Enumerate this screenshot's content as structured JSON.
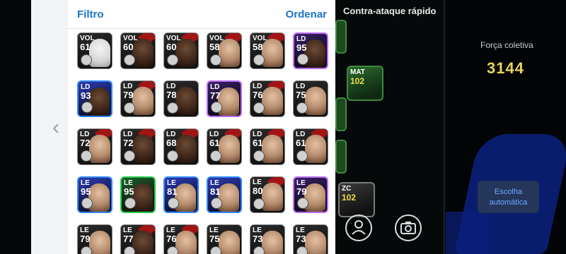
{
  "panel": {
    "filter_label": "Filtro",
    "order_label": "Ordenar"
  },
  "formation": {
    "title": "Contra-ataque rápido",
    "field_card": {
      "position": "MAT",
      "rating": "102"
    },
    "field_card_2": {
      "position": "ZC",
      "rating": "102"
    }
  },
  "team": {
    "strength_label": "Força coletiva",
    "strength_value": "3144",
    "auto_select_label": "Escolha automática"
  },
  "colors": {
    "accent_blue": "#1a73c8",
    "strength_yellow": "#e6d25a",
    "auto_button_bg": "#24365a"
  },
  "players": [
    {
      "pos": "VOL",
      "rating": "61",
      "style": "plain",
      "face": "blank",
      "stripe": false
    },
    {
      "pos": "VOL",
      "rating": "60",
      "style": "plain",
      "face": "dark",
      "stripe": true
    },
    {
      "pos": "VOL",
      "rating": "60",
      "style": "plain",
      "face": "dark",
      "stripe": true
    },
    {
      "pos": "VOL",
      "rating": "58",
      "style": "plain",
      "face": "light",
      "stripe": true
    },
    {
      "pos": "VOL",
      "rating": "58",
      "style": "plain",
      "face": "light",
      "stripe": true
    },
    {
      "pos": "LD",
      "rating": "95",
      "style": "purple",
      "face": "dark",
      "stripe": false
    },
    {
      "pos": "LD",
      "rating": "93",
      "style": "blue",
      "face": "dark",
      "stripe": false
    },
    {
      "pos": "LD",
      "rating": "79",
      "style": "plain",
      "face": "light",
      "stripe": true
    },
    {
      "pos": "LD",
      "rating": "78",
      "style": "plain",
      "face": "dark",
      "stripe": false
    },
    {
      "pos": "LD",
      "rating": "77",
      "style": "purple",
      "face": "light",
      "stripe": false
    },
    {
      "pos": "LD",
      "rating": "76",
      "style": "plain",
      "face": "light",
      "stripe": true
    },
    {
      "pos": "LD",
      "rating": "75",
      "style": "plain",
      "face": "light",
      "stripe": false
    },
    {
      "pos": "LD",
      "rating": "72",
      "style": "plain",
      "face": "light",
      "stripe": true
    },
    {
      "pos": "LD",
      "rating": "72",
      "style": "plain",
      "face": "dark",
      "stripe": true
    },
    {
      "pos": "LD",
      "rating": "68",
      "style": "plain",
      "face": "dark",
      "stripe": true
    },
    {
      "pos": "LD",
      "rating": "61",
      "style": "plain",
      "face": "light",
      "stripe": true
    },
    {
      "pos": "LD",
      "rating": "61",
      "style": "plain",
      "face": "light",
      "stripe": true
    },
    {
      "pos": "LD",
      "rating": "61",
      "style": "plain",
      "face": "light",
      "stripe": true
    },
    {
      "pos": "LE",
      "rating": "95",
      "style": "blue",
      "face": "light",
      "stripe": false
    },
    {
      "pos": "LE",
      "rating": "95",
      "style": "green",
      "face": "dark",
      "stripe": false
    },
    {
      "pos": "LE",
      "rating": "81",
      "style": "blue",
      "face": "light",
      "stripe": false
    },
    {
      "pos": "LE",
      "rating": "81",
      "style": "blue",
      "face": "light",
      "stripe": false
    },
    {
      "pos": "LE",
      "rating": "80",
      "style": "plain",
      "face": "light",
      "stripe": true
    },
    {
      "pos": "LE",
      "rating": "79",
      "style": "purple",
      "face": "light",
      "stripe": false
    },
    {
      "pos": "LE",
      "rating": "79",
      "style": "plain",
      "face": "light",
      "stripe": false
    },
    {
      "pos": "LE",
      "rating": "77",
      "style": "plain",
      "face": "dark",
      "stripe": true
    },
    {
      "pos": "LE",
      "rating": "76",
      "style": "plain",
      "face": "light",
      "stripe": true
    },
    {
      "pos": "LE",
      "rating": "75",
      "style": "plain",
      "face": "light",
      "stripe": false
    },
    {
      "pos": "LE",
      "rating": "73",
      "style": "plain",
      "face": "light",
      "stripe": false
    },
    {
      "pos": "LE",
      "rating": "73",
      "style": "plain",
      "face": "light",
      "stripe": false
    }
  ]
}
